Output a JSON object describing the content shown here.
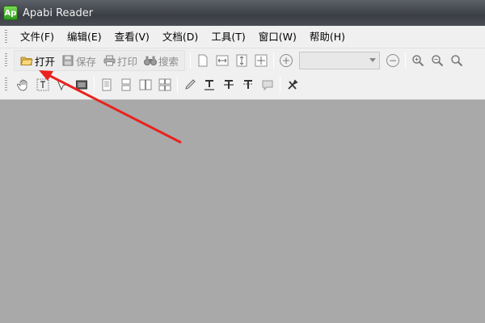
{
  "window": {
    "title": "Apabi Reader",
    "icon_label": "Ap"
  },
  "menu": [
    "文件(F)",
    "编辑(E)",
    "查看(V)",
    "文档(D)",
    "工具(T)",
    "窗口(W)",
    "帮助(H)"
  ],
  "toolbar": {
    "open_label": "打开",
    "save_label": "保存",
    "print_label": "打印",
    "search_label": "搜索",
    "zoom_value": ""
  },
  "colors": {
    "annotation_arrow": "#e8231f",
    "workspace": "#a9a9a9"
  }
}
